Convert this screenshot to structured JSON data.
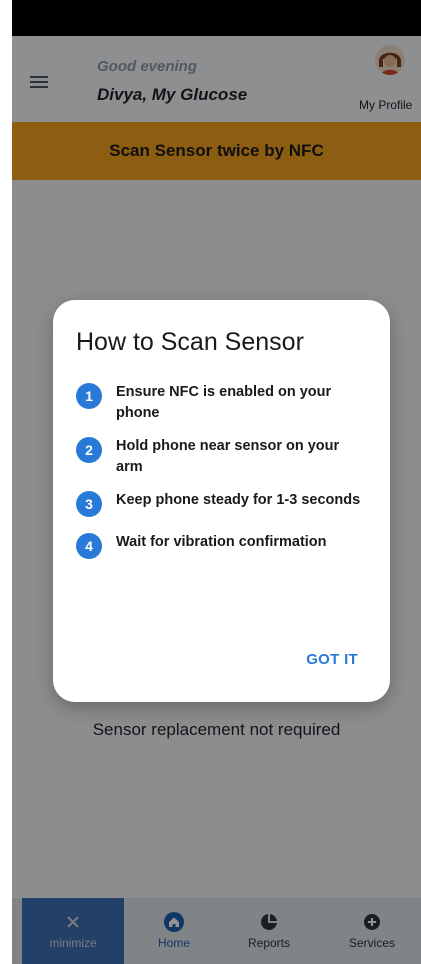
{
  "header": {
    "greeting": "Good evening",
    "user_line": "Divya, My Glucose",
    "profile_label": "My Profile"
  },
  "banner": {
    "text": "Scan Sensor twice by NFC",
    "color": "#f3a21f"
  },
  "content": {
    "replacement_status": "Sensor replacement not required"
  },
  "dialog": {
    "title": "How to Scan Sensor",
    "steps": [
      {
        "num": "1",
        "text": "Ensure NFC is enabled on your phone"
      },
      {
        "num": "2",
        "text": "Hold phone near sensor on your arm"
      },
      {
        "num": "3",
        "text": "Keep phone steady for 1-3 seconds"
      },
      {
        "num": "4",
        "text": "Wait for vibration confirmation"
      }
    ],
    "button_label": "GOT IT",
    "accent_color": "#2979d9"
  },
  "bottom_nav": {
    "items": [
      {
        "label": "minimize",
        "icon": "close-icon"
      },
      {
        "label": "Home",
        "icon": "home-icon"
      },
      {
        "label": "Reports",
        "icon": "pie-chart-icon"
      },
      {
        "label": "Services",
        "icon": "plus-circle-icon"
      }
    ]
  }
}
